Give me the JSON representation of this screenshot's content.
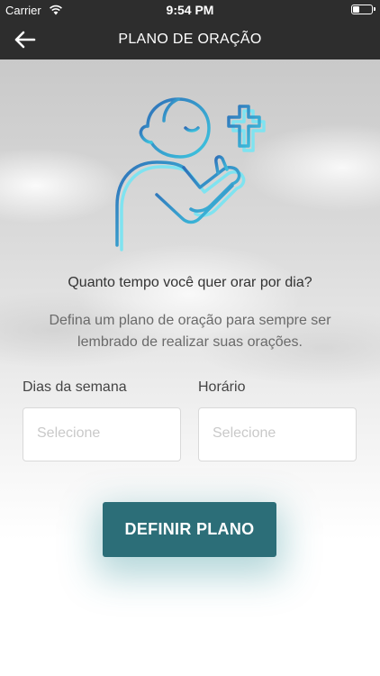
{
  "status_bar": {
    "carrier": "Carrier",
    "time": "9:54 PM"
  },
  "header": {
    "title": "PLANO DE ORAÇÃO",
    "back_icon": "arrow-left-icon"
  },
  "content": {
    "illustration_icon": "praying-person-cross-icon",
    "question": "Quanto tempo você quer orar por dia?",
    "description": "Defina um plano de oração para sempre ser lembrado de realizar suas orações."
  },
  "form": {
    "days_label": "Dias da semana",
    "days_placeholder": "Selecione",
    "time_label": "Horário",
    "time_placeholder": "Selecione"
  },
  "actions": {
    "submit_label": "DEFINIR PLANO"
  },
  "colors": {
    "primary": "#2c6e78",
    "header": "#2d2d2d",
    "icon_gradient_start": "#2f6fb8",
    "icon_gradient_end": "#3ec8e0"
  }
}
